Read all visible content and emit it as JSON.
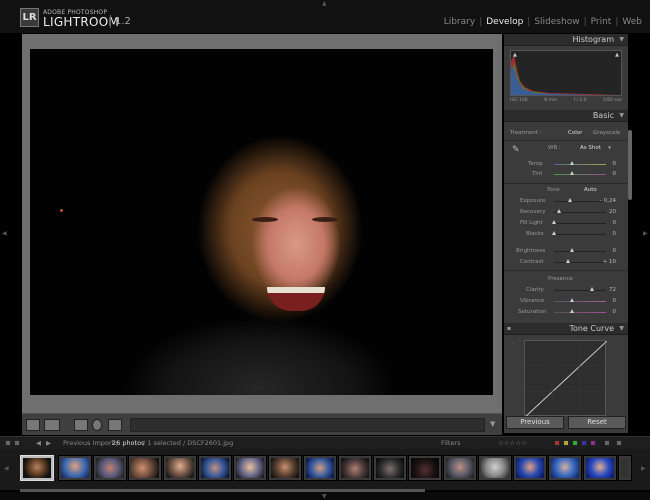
{
  "app": {
    "logo": "LR",
    "brand_small": "ADOBE PHOTOSHOP",
    "brand_name": "LIGHTROOM",
    "version": "1.2"
  },
  "modules": [
    {
      "label": "Library",
      "active": false
    },
    {
      "label": "Develop",
      "active": true
    },
    {
      "label": "Slideshow",
      "active": false
    },
    {
      "label": "Print",
      "active": false
    },
    {
      "label": "Web",
      "active": false
    }
  ],
  "histogram": {
    "title": "Histogram",
    "info": [
      "ISO 100",
      "8 mm",
      "f / 2.0",
      "1/60 sec"
    ]
  },
  "basic": {
    "title": "Basic",
    "treatment_label": "Treatment :",
    "treatment_color": "Color",
    "treatment_gray": "Grayscale",
    "wb_label": "WB :",
    "wb_value": "As Shot",
    "temp_label": "Temp",
    "temp_value": "0",
    "tint_label": "Tint",
    "tint_value": "0",
    "tone_label": "Tone",
    "auto_label": "Auto",
    "exposure_label": "Exposure",
    "exposure_value": "– 0,24",
    "recovery_label": "Recovery",
    "recovery_value": "20",
    "filllight_label": "Fill Light",
    "filllight_value": "0",
    "blacks_label": "Blacks",
    "blacks_value": "0",
    "brightness_label": "Brightness",
    "brightness_value": "0",
    "contrast_label": "Contrast",
    "contrast_value": "+ 10",
    "presence_label": "Presence",
    "clarity_label": "Clarity",
    "clarity_value": "72",
    "vibrance_label": "Vibrance",
    "vibrance_value": "0",
    "saturation_label": "Saturation",
    "saturation_value": "0"
  },
  "tone_curve": {
    "title": "Tone Curve"
  },
  "buttons": {
    "previous": "Previous",
    "reset": "Reset"
  },
  "filmstrip": {
    "source": "Previous Import /",
    "count": "26 photos",
    "selection": "/ 1 selected / DSCF2601.jpg",
    "filters_label": "Filters",
    "stars": "☆☆☆☆☆"
  },
  "colors": {
    "accent_panel": "#3b3b3b",
    "center_bg": "#6f6f6f"
  }
}
